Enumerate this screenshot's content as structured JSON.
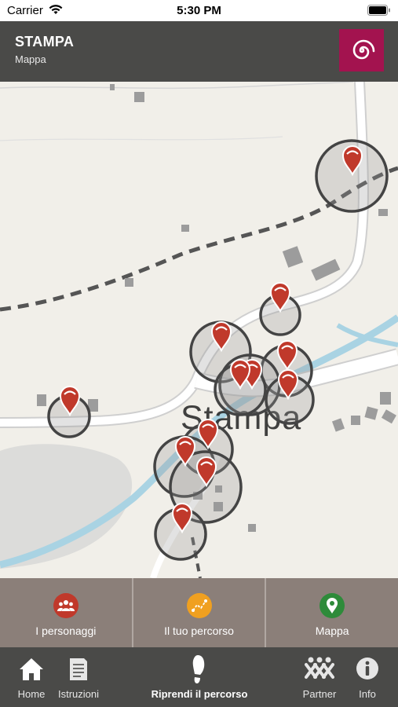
{
  "status_bar": {
    "carrier": "Carrier",
    "time": "5:30 PM"
  },
  "header": {
    "title": "STAMPA",
    "subtitle": "Mappa",
    "logo_icon": "spiral-logo-icon",
    "logo_color": "#a3134f"
  },
  "map": {
    "place_label": "Stampa",
    "marker_icon": "map-pin-icon",
    "marker_color": "#c0392b"
  },
  "tabs": [
    {
      "label": "I personaggi",
      "icon": "people-icon",
      "color": "#c0392b"
    },
    {
      "label": "Il tuo percorso",
      "icon": "route-icon",
      "color": "#f0a020"
    },
    {
      "label": "Mappa",
      "icon": "map-pin-icon",
      "color": "#2e8b3a"
    }
  ],
  "nav": [
    {
      "label": "Home",
      "icon": "home-icon"
    },
    {
      "label": "Istruzioni",
      "icon": "document-icon"
    },
    {
      "label": "Riprendi il percorso",
      "icon": "footprint-icon"
    },
    {
      "label": "Partner",
      "icon": "partner-icon"
    },
    {
      "label": "Info",
      "icon": "info-icon"
    }
  ]
}
